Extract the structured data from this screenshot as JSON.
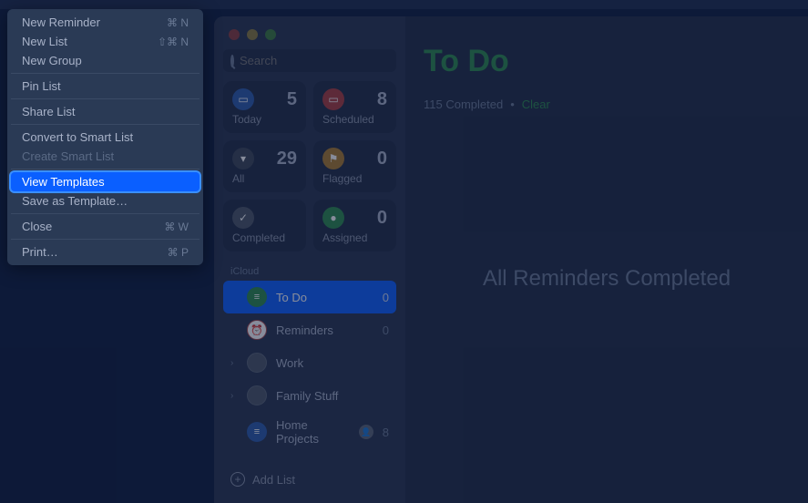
{
  "menu": {
    "items": [
      {
        "label": "New Reminder",
        "shortcut": "⌘ N"
      },
      {
        "label": "New List",
        "shortcut": "⇧⌘ N"
      },
      {
        "label": "New Group",
        "shortcut": ""
      },
      {
        "sep": true
      },
      {
        "label": "Pin List",
        "shortcut": ""
      },
      {
        "sep": true
      },
      {
        "label": "Share List",
        "shortcut": ""
      },
      {
        "sep": true
      },
      {
        "label": "Convert to Smart List",
        "shortcut": ""
      },
      {
        "label": "Create Smart List",
        "shortcut": "",
        "disabled": true
      },
      {
        "sep": true
      },
      {
        "label": "View Templates",
        "shortcut": "",
        "highlighted": true
      },
      {
        "label": "Save as Template…",
        "shortcut": ""
      },
      {
        "sep": true
      },
      {
        "label": "Close",
        "shortcut": "⌘ W"
      },
      {
        "sep": true
      },
      {
        "label": "Print…",
        "shortcut": "⌘ P"
      }
    ]
  },
  "search": {
    "placeholder": "Search"
  },
  "cards": {
    "today": {
      "label": "Today",
      "count": "5"
    },
    "scheduled": {
      "label": "Scheduled",
      "count": "8"
    },
    "all": {
      "label": "All",
      "count": "29"
    },
    "flagged": {
      "label": "Flagged",
      "count": "0"
    },
    "completed": {
      "label": "Completed",
      "count": ""
    },
    "assigned": {
      "label": "Assigned",
      "count": "0"
    }
  },
  "section": "iCloud",
  "lists": [
    {
      "name": "To Do",
      "count": "0",
      "selected": true,
      "color": "li-green",
      "icon": "≡"
    },
    {
      "name": "Reminders",
      "count": "0",
      "color": "li-red",
      "icon": "⏰"
    },
    {
      "name": "Work",
      "count": "",
      "expandable": true,
      "color": "li-gray",
      "icon": ""
    },
    {
      "name": "Family Stuff",
      "count": "",
      "expandable": true,
      "color": "li-gray",
      "icon": ""
    },
    {
      "name": "Home Projects",
      "count": "8",
      "shared": true,
      "color": "li-blue",
      "icon": "≡"
    }
  ],
  "addList": "Add List",
  "main": {
    "title": "To Do",
    "completed": "115 Completed",
    "sep": "•",
    "clear": "Clear",
    "empty": "All Reminders Completed"
  }
}
